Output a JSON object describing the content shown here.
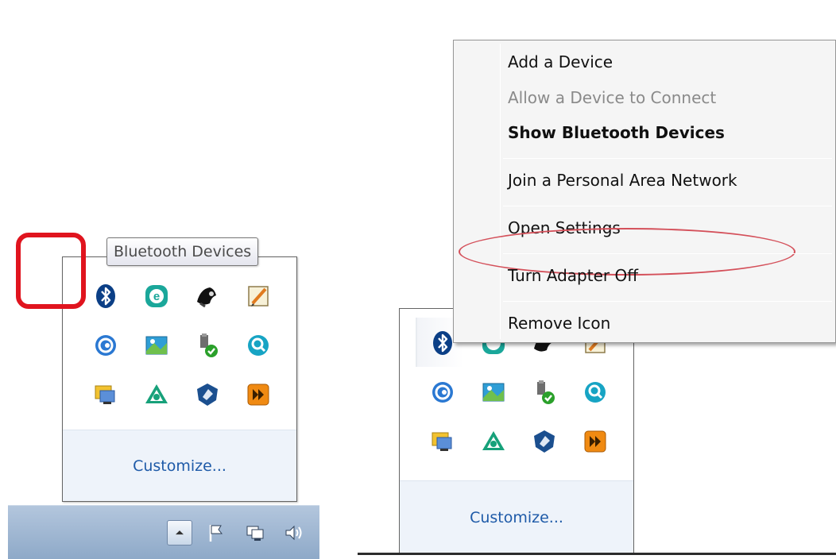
{
  "left": {
    "tooltip": "Bluetooth Devices",
    "customize": "Customize...",
    "icons": [
      [
        "bluetooth-icon",
        "eset-icon",
        "media-player-icon",
        "notepad-icon"
      ],
      [
        "swirl-icon",
        "photo-sync-icon",
        "usb-safely-remove-icon",
        "magnifier-icon"
      ],
      [
        "network-monitor-icon",
        "triangle-sync-icon",
        "shield-icon",
        "play-forward-icon"
      ]
    ],
    "taskbar_icons": [
      "show-hidden-icons-arrow-icon",
      "action-center-flag-icon",
      "network-icon",
      "volume-icon"
    ]
  },
  "right": {
    "customize": "Customize...",
    "context_menu": {
      "items": [
        {
          "label": "Add a Device",
          "state": "normal"
        },
        {
          "label": "Allow a Device to Connect",
          "state": "disabled"
        },
        {
          "label": "Show Bluetooth Devices",
          "state": "default"
        },
        {
          "label": "Join a Personal Area Network",
          "state": "normal"
        },
        {
          "label": "Open Settings",
          "state": "highlighted"
        },
        {
          "label": "Turn Adapter Off",
          "state": "normal"
        },
        {
          "label": "Remove Icon",
          "state": "normal"
        }
      ]
    }
  },
  "colors": {
    "highlight_red": "#e0141e",
    "ellipse_red": "#d4505a",
    "link_blue": "#1e5aa8",
    "taskbar_blue": "#9bb3cf"
  }
}
